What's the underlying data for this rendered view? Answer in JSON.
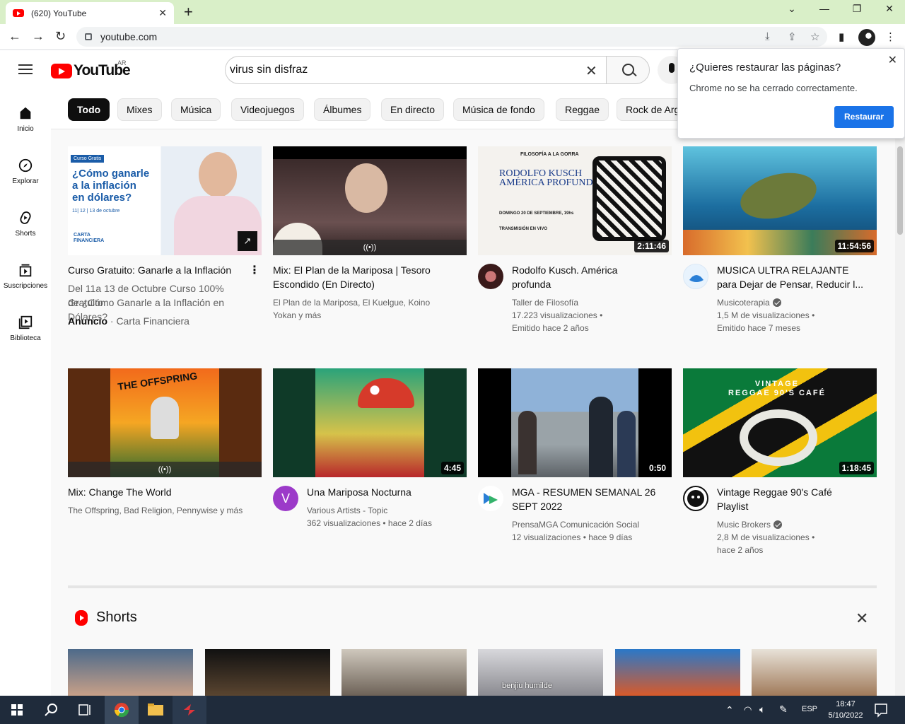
{
  "browser": {
    "tab_title": "(620) YouTube",
    "url": "youtube.com",
    "new_tab": "+",
    "win_min": "⌄",
    "win_restore": "—",
    "win_max": "❐",
    "win_close": "✕"
  },
  "header": {
    "logo_text": "YouTube",
    "country_code": "AR",
    "search_value": "virus sin disfraz"
  },
  "chips": [
    "Todo",
    "Mixes",
    "Música",
    "Videojuegos",
    "Álbumes",
    "En directo",
    "Música de fondo",
    "Reggae",
    "Rock de Arg"
  ],
  "sidebar": [
    {
      "label": "Inicio",
      "icon": "home-icon"
    },
    {
      "label": "Explorar",
      "icon": "compass-icon"
    },
    {
      "label": "Shorts",
      "icon": "shorts-icon"
    },
    {
      "label": "Suscripciones",
      "icon": "subscriptions-icon"
    },
    {
      "label": "Biblioteca",
      "icon": "library-icon"
    }
  ],
  "popup": {
    "title": "¿Quieres restaurar las páginas?",
    "body": "Chrome no se ha cerrado correctamente.",
    "button": "Restaurar"
  },
  "videos": [
    {
      "title_1": "Curso Gratuito: Ganarle a la Inflación",
      "title_2": "",
      "meta_1": "Del 11a 13 de Octubre Curso 100% Gratuito",
      "meta_2": "de ¿Cómo Ganarle a la Inflación en Dólares?",
      "meta_3_bold": "Anuncio",
      "meta_3": "· Carta Financiera",
      "duration": ""
    },
    {
      "title_1": "Mix: El Plan de la Mariposa | Tesoro",
      "title_2": "Escondido (En Directo)",
      "meta_1": "El Plan de la Mariposa, El Kuelgue, Koino",
      "meta_2": "Yokan y más",
      "duration": "((•))"
    },
    {
      "title_1": "Rodolfo Kusch. América",
      "title_2": "profunda",
      "meta_1": "Taller de Filosofía",
      "meta_2": "17.223 visualizaciones •",
      "meta_3": "Emitido hace 2 años",
      "duration": "2:11:46"
    },
    {
      "title_1": "MUSICA ULTRA RELAJANTE",
      "title_2": "para Dejar de Pensar, Reducir l...",
      "meta_1": "Musicoterapia",
      "meta_2": "1,5 M de visualizaciones •",
      "meta_3": "Emitido hace 7 meses",
      "duration": "11:54:56"
    },
    {
      "title_1": "Mix: Change The World",
      "title_2": "",
      "meta_1": "The Offspring, Bad Religion, Pennywise y más",
      "duration": "((•))"
    },
    {
      "title_1": "Una Mariposa Nocturna",
      "title_2": "",
      "meta_1": "Various Artists - Topic",
      "meta_2": "362 visualizaciones • hace 2 días",
      "duration": "4:45",
      "avatar_letter": "V"
    },
    {
      "title_1": "MGA - RESUMEN SEMANAL 26",
      "title_2": "SEPT 2022",
      "meta_1": "PrensaMGA Comunicación Social",
      "meta_2": "12 visualizaciones • hace 9 días",
      "duration": "0:50"
    },
    {
      "title_1": "Vintage Reggae 90's Café",
      "title_2": "Playlist",
      "meta_1": "Music Brokers",
      "meta_2": "2,8 M de visualizaciones •",
      "meta_3": "hace 2 años",
      "duration": "1:18:45"
    }
  ],
  "thumb_text": {
    "ad_badge": "Curso Gratis",
    "ad_line1": "¿Cómo ganarle",
    "ad_line2": "a la inflación",
    "ad_line3": "en dólares?",
    "ad_dates": "11| 12 | 13 de octubre",
    "ad_brand1": "CARTA",
    "ad_brand2": "FINANCIERA",
    "kusch_head": "FILOSOFÍA A LA GORRA",
    "kusch_name1": "RODOLFO KUSCH",
    "kusch_name2": "AMÉRICA PROFUNDA",
    "kusch_date": "DOMINGO 20 DE SEPTIEMBRE, 19hs",
    "kusch_trans": "TRANSMISIÓN EN VIVO",
    "reggae_1": "VINTAGE",
    "reggae_2": "REGGAE 90'S CAFÉ",
    "offspring": "THE OFFSPRING"
  },
  "shorts": {
    "title": "Shorts",
    "caption_4": "benjiu humilde"
  },
  "taskbar": {
    "lang": "ESP",
    "time": "18:47",
    "date": "5/10/2022"
  },
  "colors": {
    "tabstrip": "#d9efc8",
    "yt_red": "#ff0000",
    "button_blue": "#1a73e8",
    "taskbar": "#1f2b3b"
  }
}
